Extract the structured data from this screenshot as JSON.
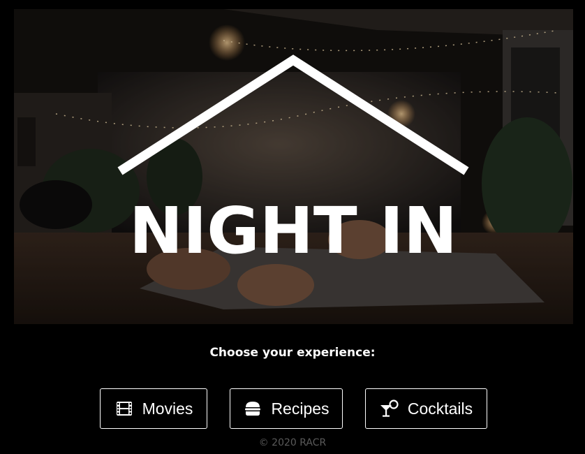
{
  "hero": {
    "logo_text": "NIGHT IN"
  },
  "prompt": "Choose your experience:",
  "buttons": {
    "movies": {
      "label": "Movies",
      "icon": "film-icon"
    },
    "recipes": {
      "label": "Recipes",
      "icon": "burger-icon"
    },
    "cocktails": {
      "label": "Cocktails",
      "icon": "cocktail-icon"
    }
  },
  "footer": "© 2020 RACR",
  "colors": {
    "background": "#000000",
    "text": "#ffffff",
    "footer_text": "#5a5a5a"
  }
}
